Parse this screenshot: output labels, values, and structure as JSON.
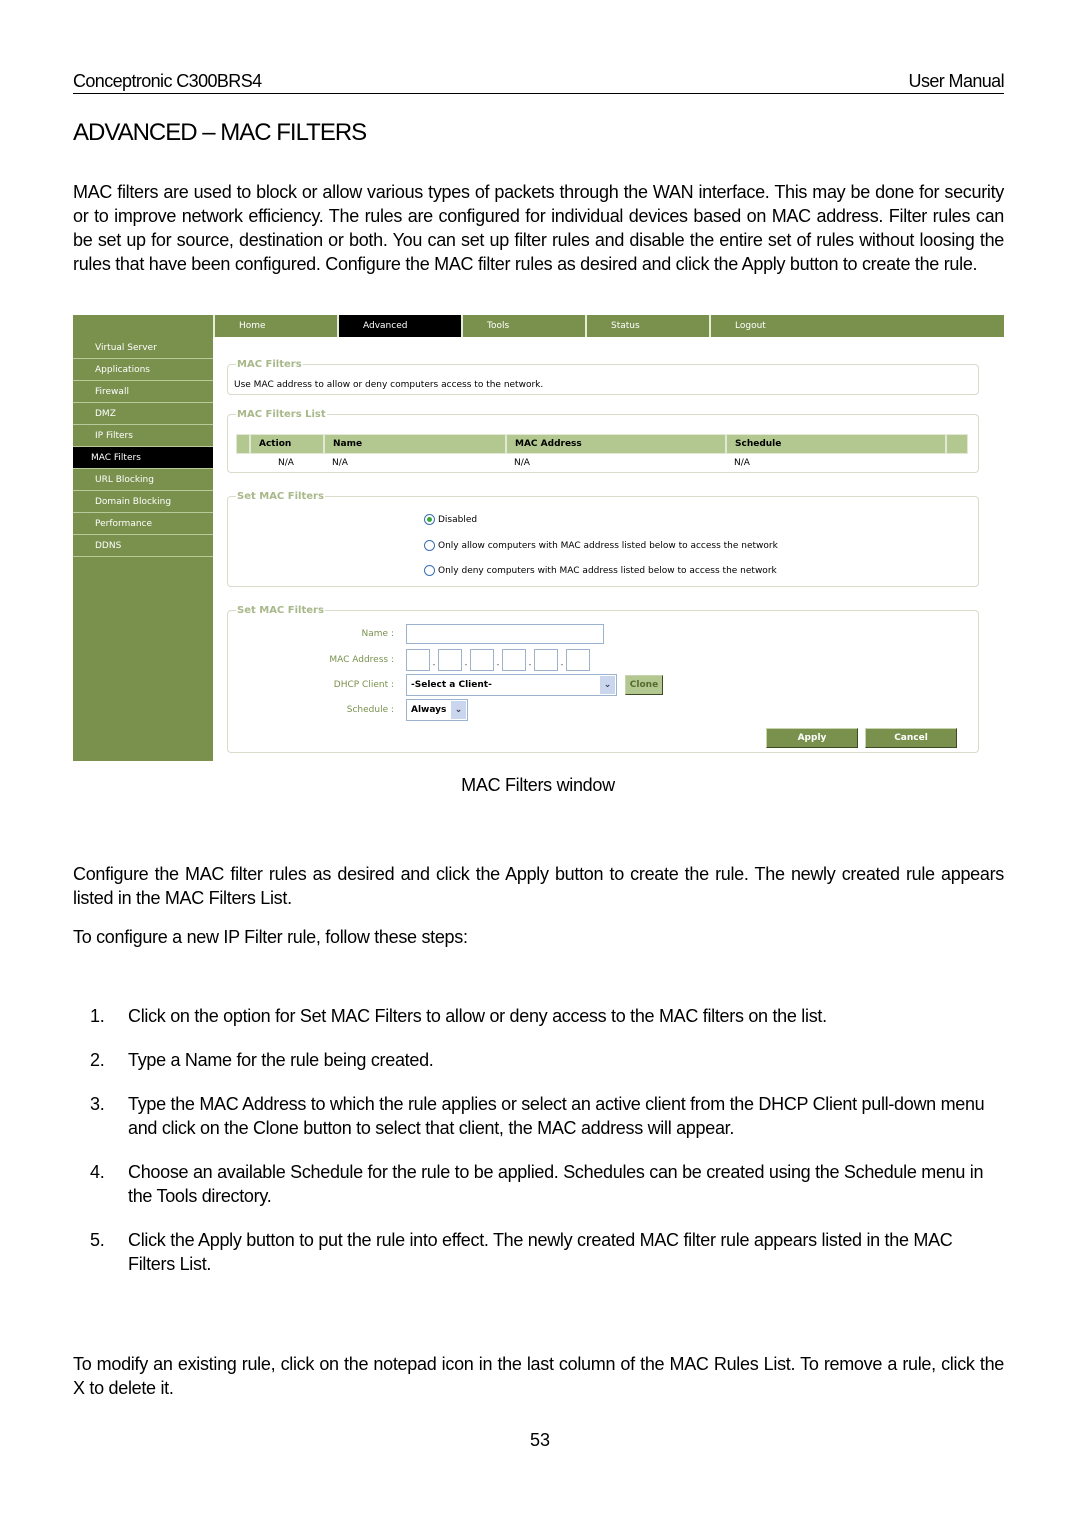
{
  "header": {
    "left": "Conceptronic C300BRS4",
    "right": "User Manual"
  },
  "title": "ADVANCED – MAC FILTERS",
  "intro": "MAC filters are used to block or allow various types of packets through the WAN interface. This may be done for security or to improve network efficiency. The rules are configured for individual devices based on MAC address. Filter rules can be set up for source, destination or both. You can set up filter rules and disable the entire set of rules without loosing the rules that have been configured. Configure the MAC filter rules as desired and click the Apply button to create the rule.",
  "ui": {
    "nav": [
      {
        "label": "Home"
      },
      {
        "label": "Advanced",
        "active": true
      },
      {
        "label": "Tools"
      },
      {
        "label": "Status"
      },
      {
        "label": "Logout"
      }
    ],
    "sidebar": [
      {
        "label": "Virtual Server"
      },
      {
        "label": "Applications"
      },
      {
        "label": "Firewall"
      },
      {
        "label": "DMZ"
      },
      {
        "label": "IP Filters"
      },
      {
        "label": "MAC Filters",
        "active": true
      },
      {
        "label": "URL Blocking"
      },
      {
        "label": "Domain Blocking"
      },
      {
        "label": "Performance"
      },
      {
        "label": "DDNS"
      }
    ],
    "mac_filters": {
      "legend": "MAC Filters",
      "desc": "Use MAC address to allow or deny computers access to the network."
    },
    "list": {
      "legend": "MAC Filters List",
      "columns": [
        "Action",
        "Name",
        "MAC Address",
        "Schedule"
      ],
      "row": [
        "N/A",
        "N/A",
        "N/A",
        "N/A"
      ]
    },
    "mode": {
      "legend": "Set MAC Filters",
      "options": [
        {
          "label": "Disabled",
          "selected": true
        },
        {
          "label": "Only allow computers with MAC address listed below to access the network",
          "selected": false
        },
        {
          "label": "Only deny computers with MAC address listed below to access the network",
          "selected": false
        }
      ]
    },
    "form": {
      "legend": "Set MAC Filters",
      "name_label": "Name :",
      "name_value": "",
      "mac_label": "MAC Address :",
      "dhcp_label": "DHCP Client :",
      "dhcp_value": "-Select a Client-",
      "clone_label": "Clone",
      "schedule_label": "Schedule :",
      "schedule_value": "Always",
      "apply_label": "Apply",
      "cancel_label": "Cancel"
    },
    "colors": {
      "brand_green": "#7a914e",
      "header_green": "#b3c890",
      "active": "#000000"
    }
  },
  "caption": "MAC Filters window",
  "para2": "Configure the MAC filter rules as desired and click the Apply button to create the rule. The newly created rule appears listed in the MAC Filters List.",
  "para3": "To configure a new IP Filter rule, follow these steps:",
  "steps": [
    {
      "num": "1.",
      "text": "Click on the option for Set MAC Filters to allow or deny access to the MAC filters on the list."
    },
    {
      "num": "2.",
      "text": "Type a Name for the rule being created."
    },
    {
      "num": "3.",
      "text": "Type the MAC Address to which the rule applies or select an active client from the DHCP Client pull-down menu and click on the Clone button to select that client, the MAC address will appear."
    },
    {
      "num": "4.",
      "text": "Choose an available Schedule for the rule to be applied. Schedules can be created using the Schedule menu in the Tools directory."
    },
    {
      "num": "5.",
      "text": "Click the Apply button to put the rule into effect. The newly created MAC filter rule appears listed in the MAC Filters List."
    }
  ],
  "para4": "To modify an existing rule, click on the notepad icon in the last column of the MAC Rules List. To remove a rule, click the X to delete it.",
  "page_number": "53"
}
